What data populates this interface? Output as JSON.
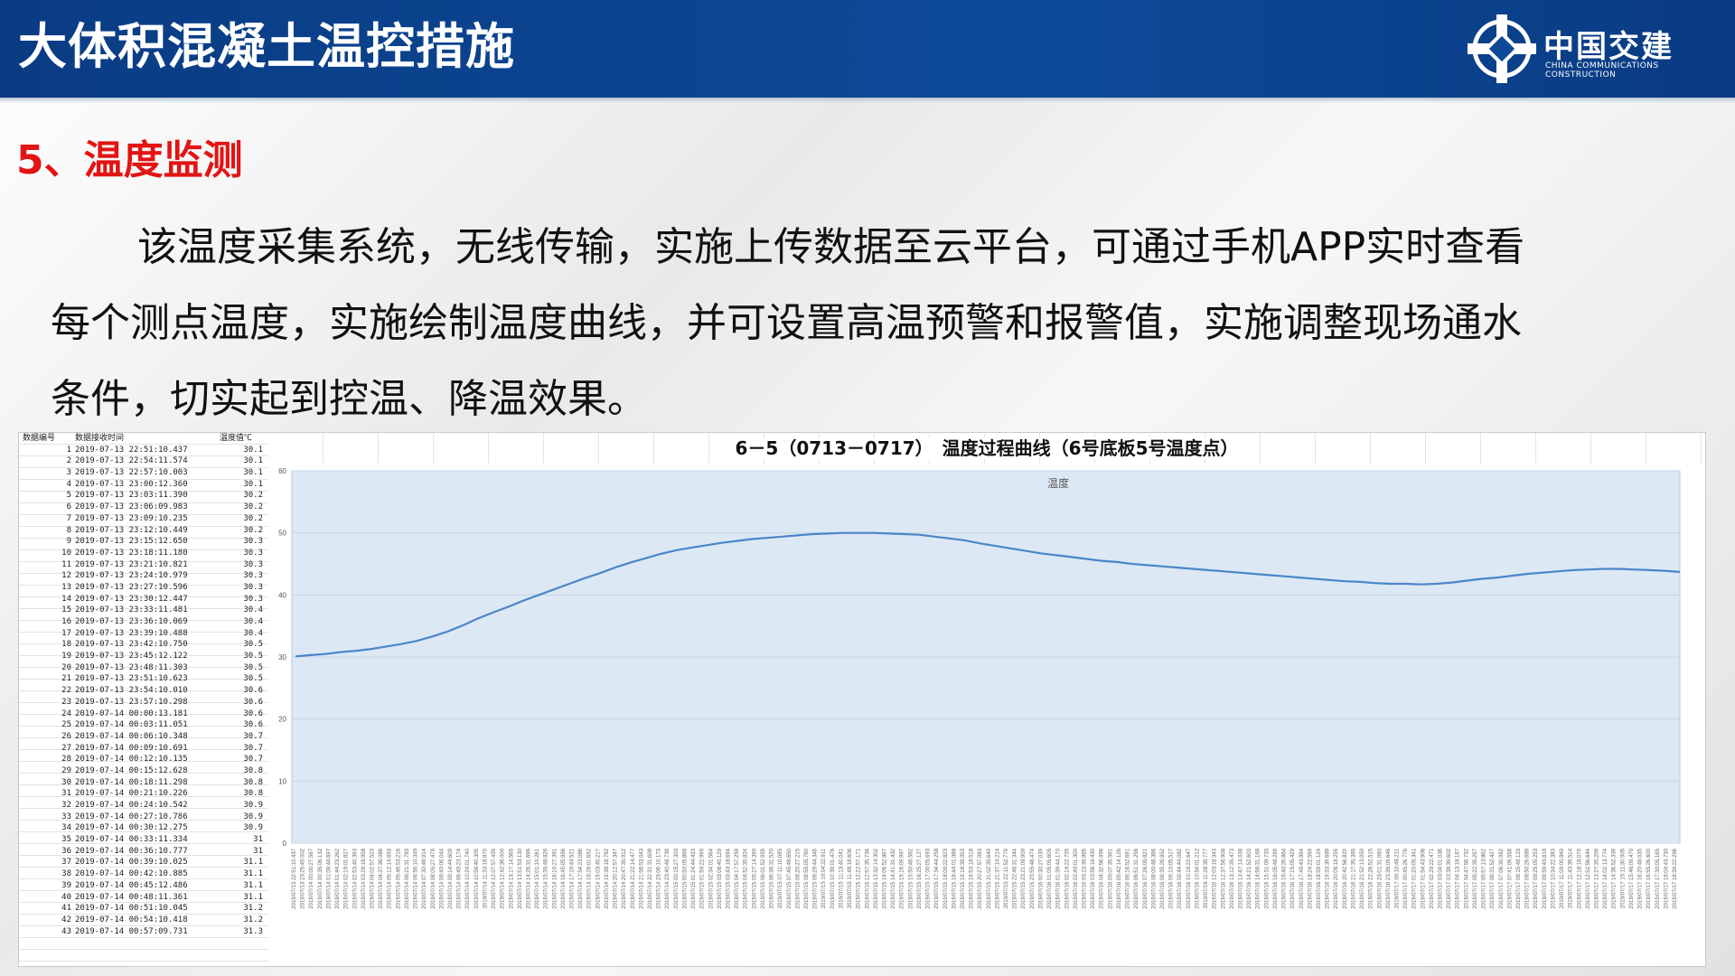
{
  "header": {
    "title": "大体积混凝土温控措施",
    "logo_cn": "中国交建",
    "logo_en": "CHINA COMMUNICATIONS CONSTRUCTION"
  },
  "section": {
    "title": "5、温度监测",
    "paragraph_lines": [
      "该温度采集系统，无线传输，实施上传数据至云平台，可通过手机APP实时查看",
      "每个测点温度，实施绘制温度曲线，并可设置高温预警和报警值，实施调整现场通水",
      "条件，切实起到控温、降温效果。"
    ]
  },
  "table": {
    "headers": [
      "数据编号",
      "数据接收时间",
      "温度值℃"
    ],
    "rows": [
      [
        "1",
        "2019-07-13 22:51:10.437",
        "30.1"
      ],
      [
        "2",
        "2019-07-13 22:54:11.574",
        "30.1"
      ],
      [
        "3",
        "2019-07-13 22:57:10.003",
        "30.1"
      ],
      [
        "4",
        "2019-07-13 23:00:12.360",
        "30.1"
      ],
      [
        "5",
        "2019-07-13 23:03:11.390",
        "30.2"
      ],
      [
        "6",
        "2019-07-13 23:06:09.983",
        "30.2"
      ],
      [
        "7",
        "2019-07-13 23:09:10.235",
        "30.2"
      ],
      [
        "8",
        "2019-07-13 23:12:10.449",
        "30.2"
      ],
      [
        "9",
        "2019-07-13 23:15:12.650",
        "30.3"
      ],
      [
        "10",
        "2019-07-13 23:18:11.180",
        "30.3"
      ],
      [
        "11",
        "2019-07-13 23:21:10.821",
        "30.3"
      ],
      [
        "12",
        "2019-07-13 23:24:10.979",
        "30.3"
      ],
      [
        "13",
        "2019-07-13 23:27:10.596",
        "30.3"
      ],
      [
        "14",
        "2019-07-13 23:30:12.447",
        "30.3"
      ],
      [
        "15",
        "2019-07-13 23:33:11.481",
        "30.4"
      ],
      [
        "16",
        "2019-07-13 23:36:10.069",
        "30.4"
      ],
      [
        "17",
        "2019-07-13 23:39:10.488",
        "30.4"
      ],
      [
        "18",
        "2019-07-13 23:42:10.750",
        "30.5"
      ],
      [
        "19",
        "2019-07-13 23:45:12.122",
        "30.5"
      ],
      [
        "20",
        "2019-07-13 23:48:11.303",
        "30.5"
      ],
      [
        "21",
        "2019-07-13 23:51:10.623",
        "30.5"
      ],
      [
        "22",
        "2019-07-13 23:54:10.010",
        "30.6"
      ],
      [
        "23",
        "2019-07-13 23:57:10.298",
        "30.6"
      ],
      [
        "24",
        "2019-07-14 00:00:13.181",
        "30.6"
      ],
      [
        "25",
        "2019-07-14 00:03:11.051",
        "30.6"
      ],
      [
        "26",
        "2019-07-14 00:06:10.348",
        "30.7"
      ],
      [
        "27",
        "2019-07-14 00:09:10.691",
        "30.7"
      ],
      [
        "28",
        "2019-07-14 00:12:10.135",
        "30.7"
      ],
      [
        "29",
        "2019-07-14 00:15:12.628",
        "30.8"
      ],
      [
        "30",
        "2019-07-14 00:18:11.298",
        "30.8"
      ],
      [
        "31",
        "2019-07-14 00:21:10.226",
        "30.8"
      ],
      [
        "32",
        "2019-07-14 00:24:10.542",
        "30.9"
      ],
      [
        "33",
        "2019-07-14 00:27:10.786",
        "30.9"
      ],
      [
        "34",
        "2019-07-14 00:30:12.275",
        "30.9"
      ],
      [
        "35",
        "2019-07-14 00:33:11.334",
        "31"
      ],
      [
        "36",
        "2019-07-14 00:36:10.777",
        "31"
      ],
      [
        "37",
        "2019-07-14 00:39:10.025",
        "31.1"
      ],
      [
        "38",
        "2019-07-14 00:42:10.885",
        "31.1"
      ],
      [
        "39",
        "2019-07-14 00:45:12.486",
        "31.1"
      ],
      [
        "40",
        "2019-07-14 00:48:11.361",
        "31.1"
      ],
      [
        "41",
        "2019-07-14 00:51:10.045",
        "31.2"
      ],
      [
        "42",
        "2019-07-14 00:54:10.418",
        "31.2"
      ],
      [
        "43",
        "2019-07-14 00:57:09.731",
        "31.3"
      ]
    ]
  },
  "colors": {
    "header_bg": "#0b4490",
    "section_title": "#e31414",
    "line": "#4a86c8",
    "plot_bg": "#dde8f5"
  },
  "chart_data": {
    "type": "line",
    "title": "6－5（0713－0717）　温度过程曲线（6号底板5号温度点）",
    "legend": "温度",
    "legend_position": "top-center",
    "ylim": [
      0,
      60
    ],
    "yticks": [
      0,
      10,
      20,
      30,
      40,
      50,
      60
    ],
    "grid": true,
    "x_count": 160,
    "x_first": "2019/07/13 22:51:10.437",
    "x_last": "2019/07/17 18:39:22.296",
    "series": [
      {
        "name": "温度",
        "values": [
          30.1,
          30.3,
          30.5,
          30.8,
          31.0,
          31.3,
          31.7,
          32.1,
          32.6,
          33.3,
          34.1,
          35.1,
          36.2,
          37.2,
          38.1,
          39.1,
          40.0,
          40.9,
          41.8,
          42.7,
          43.5,
          44.4,
          45.2,
          45.9,
          46.6,
          47.2,
          47.6,
          48.0,
          48.4,
          48.7,
          49.0,
          49.2,
          49.4,
          49.6,
          49.8,
          49.9,
          50.0,
          50.0,
          50.0,
          49.9,
          49.8,
          49.7,
          49.4,
          49.1,
          48.8,
          48.3,
          47.9,
          47.5,
          47.1,
          46.7,
          46.4,
          46.1,
          45.8,
          45.5,
          45.3,
          45.0,
          44.8,
          44.6,
          44.4,
          44.2,
          44.0,
          43.8,
          43.6,
          43.4,
          43.2,
          43.0,
          42.8,
          42.6,
          42.4,
          42.2,
          42.1,
          41.9,
          41.8,
          41.8,
          41.7,
          41.8,
          42.0,
          42.3,
          42.6,
          42.8,
          43.1,
          43.4,
          43.6,
          43.8,
          44.0,
          44.1,
          44.2,
          44.2,
          44.1,
          44.0,
          43.9,
          43.7
        ]
      }
    ]
  }
}
